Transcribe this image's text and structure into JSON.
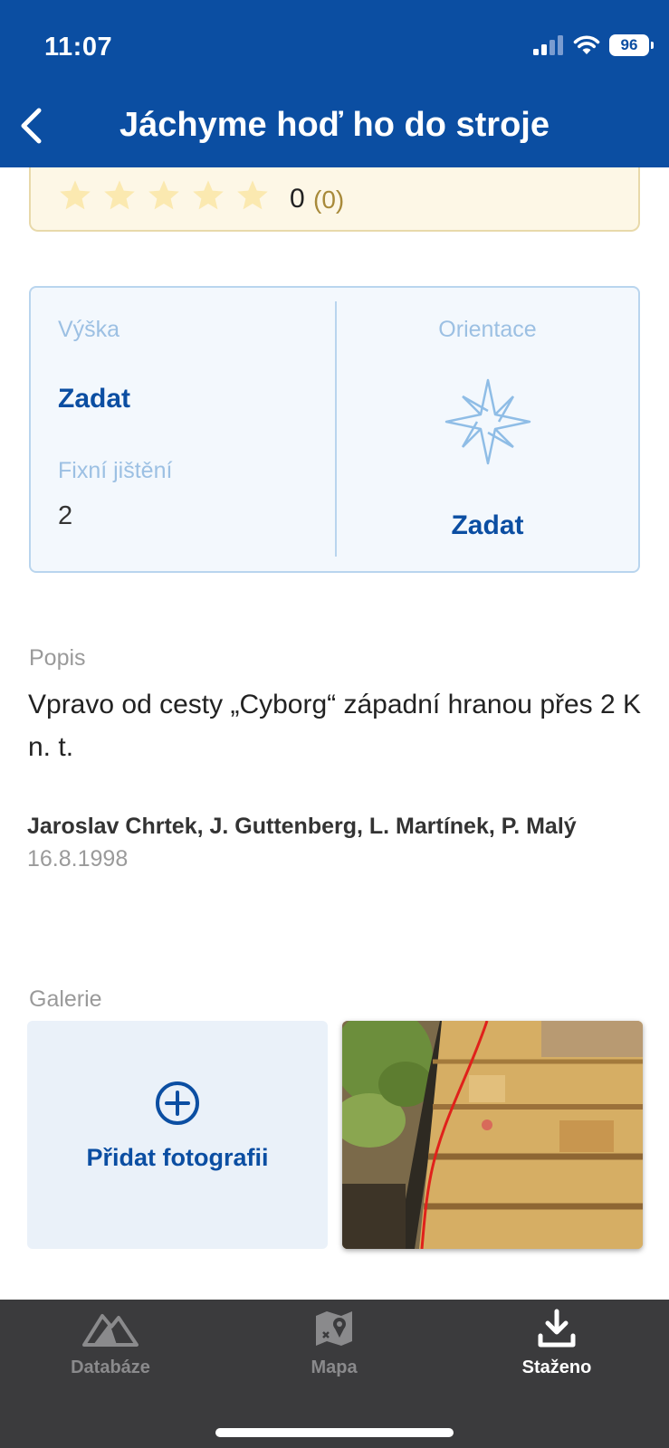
{
  "status_bar": {
    "time": "11:07",
    "battery": "96"
  },
  "header": {
    "title": "Jáchyme hoď ho do stroje"
  },
  "rating": {
    "value": "0",
    "count": "(0)",
    "stars": 5,
    "filled": 0
  },
  "info": {
    "height_label": "Výška",
    "height_value": "Zadat",
    "bolts_label": "Fixní jištění",
    "bolts_value": "2",
    "orientation_label": "Orientace",
    "orientation_value": "Zadat"
  },
  "description": {
    "label": "Popis",
    "text": "Vpravo od cesty „Cyborg“ západní hranou přes 2 K n. t.",
    "authors": "Jaroslav Chrtek, J. Guttenberg, L. Martínek, P. Malý",
    "date": "16.8.1998"
  },
  "gallery": {
    "label": "Galerie",
    "add_label": "Přidat fotografii"
  },
  "tabs": [
    {
      "label": "Databáze",
      "icon": "mountain-icon",
      "active": false
    },
    {
      "label": "Mapa",
      "icon": "map-icon",
      "active": false
    },
    {
      "label": "Staženo",
      "icon": "download-icon",
      "active": true
    }
  ],
  "colors": {
    "primary": "#0b4ea2",
    "tab_bar": "#3b3b3d",
    "rating_bg": "#fdf7e6",
    "star": "#fbe9b0"
  }
}
